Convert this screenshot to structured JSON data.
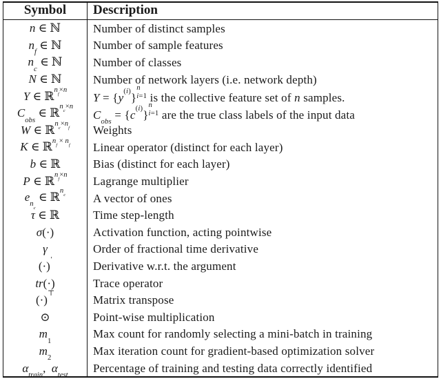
{
  "table": {
    "headers": {
      "symbol": "Symbol",
      "description": "Description"
    },
    "rows": [
      {
        "symbol_text": "n ∈ ℕ",
        "description": "Number of distinct samples"
      },
      {
        "symbol_text": "n_f ∈ ℕ",
        "description": "Number of sample features"
      },
      {
        "symbol_text": "n_c ∈ ℕ",
        "description": "Number of classes"
      },
      {
        "symbol_text": "N ∈ ℕ",
        "description": "Number of network layers (i.e. network depth)"
      },
      {
        "symbol_text": "Y ∈ ℝ^{n_f×n}",
        "description": "Y = {y^(i)}_{i=1}^{n} is the collective feature set of n samples."
      },
      {
        "symbol_text": "C_obs ∈ ℝ^{n_c×n}",
        "description": "C_obs = {c^(i)}_{i=1}^{n} are the true class labels of the input data"
      },
      {
        "symbol_text": "W ∈ ℝ^{n_c×n_f}",
        "description": "Weights"
      },
      {
        "symbol_text": "K ∈ ℝ^{n_f × n_f}",
        "description": "Linear operator (distinct for each layer)"
      },
      {
        "symbol_text": "b ∈ ℝ",
        "description": "Bias (distinct for each layer)"
      },
      {
        "symbol_text": "P ∈ ℝ^{n_f×n}",
        "description": "Lagrange multiplier"
      },
      {
        "symbol_text": "e_{n_c} ∈ ℝ^{n_c}",
        "description": "A vector of ones"
      },
      {
        "symbol_text": "τ ∈ ℝ",
        "description": "Time step-length"
      },
      {
        "symbol_text": "σ(·)",
        "description": "Activation function, acting pointwise"
      },
      {
        "symbol_text": "γ",
        "description": "Order of fractional time derivative"
      },
      {
        "symbol_text": "(·)′",
        "description": "Derivative w.r.t. the argument"
      },
      {
        "symbol_text": "tr(·)",
        "description": "Trace operator"
      },
      {
        "symbol_text": "(·)⊤",
        "description": "Matrix transpose"
      },
      {
        "symbol_text": "⊙",
        "description": "Point-wise multiplication"
      },
      {
        "symbol_text": "m_1",
        "description": "Max count for randomly selecting a mini-batch in training"
      },
      {
        "symbol_text": "m_2",
        "description": "Max iteration count for gradient-based optimization solver"
      },
      {
        "symbol_text": "α_train, α_test",
        "description": "Percentage of training and testing data correctly identified"
      }
    ]
  }
}
